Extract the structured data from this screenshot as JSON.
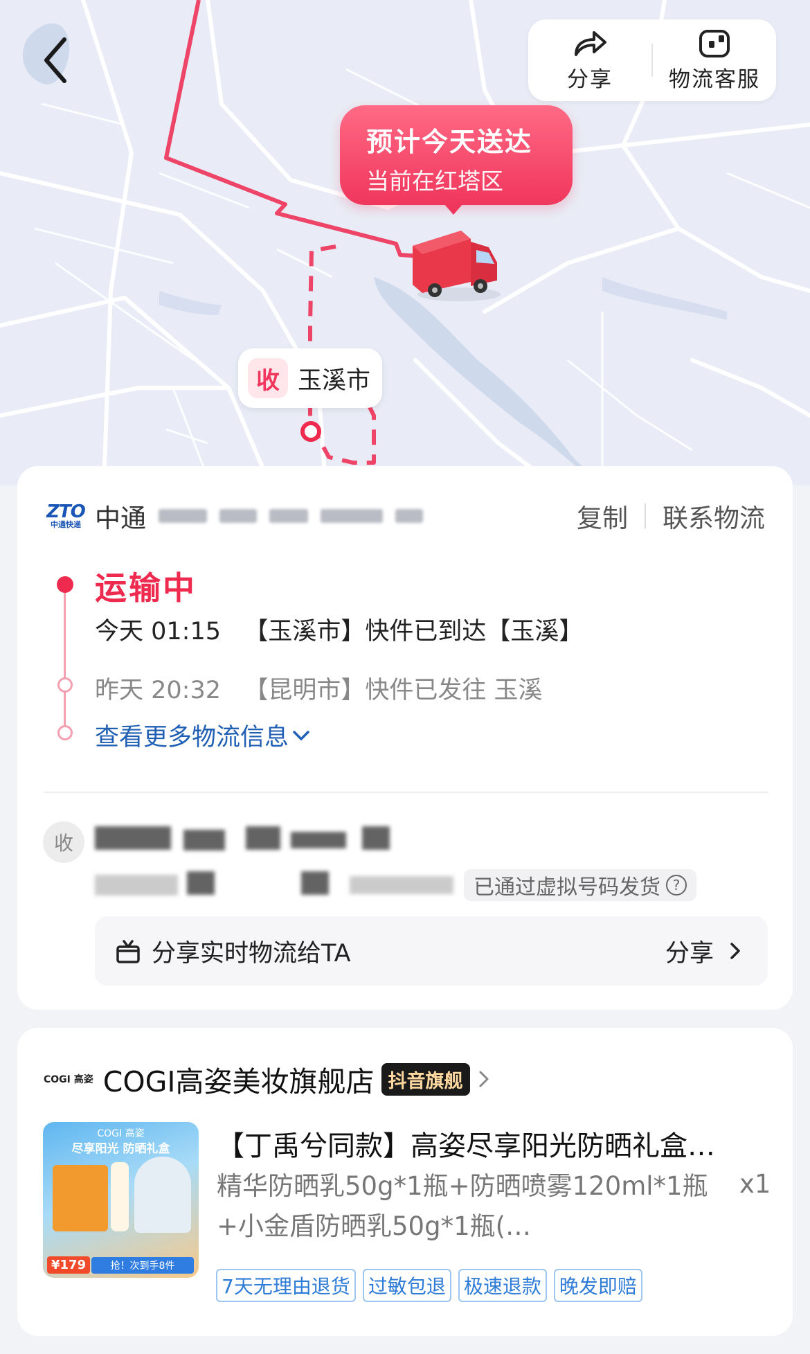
{
  "map": {
    "eta_title": "预计今天送达",
    "eta_subtitle": "当前在红塔区",
    "destination_badge": "收",
    "destination_name": "玉溪市"
  },
  "top_actions": {
    "share_label": "分享",
    "service_label": "物流客服"
  },
  "carrier": {
    "logo_text": "ZTO",
    "logo_sub": "中通快递",
    "name_prefix": "中通",
    "copy_label": "复制",
    "contact_label": "联系物流"
  },
  "tracking": {
    "status": "运输中",
    "events": [
      {
        "time": "今天 01:15",
        "text": "【玉溪市】快件已到达【玉溪】"
      },
      {
        "time": "昨天 20:32",
        "text": "【昆明市】快件已发往 玉溪"
      }
    ],
    "more_label": "查看更多物流信息"
  },
  "receiver": {
    "badge": "收",
    "virtual_tag": "已通过虚拟号码发货",
    "help_icon": "?"
  },
  "share_box": {
    "label": "分享实时物流给TA",
    "action": "分享"
  },
  "store": {
    "logo": "COGI 高姿",
    "name": "COGI高姿美妆旗舰店",
    "tag": "抖音旗舰"
  },
  "product": {
    "image_logo": "COGI 高姿",
    "image_title": "尽享阳光 防晒礼盒",
    "image_price": "¥179",
    "image_strip": "抢！次到手8件",
    "title": "【丁禹兮同款】高姿尽享阳光防晒礼盒…",
    "spec": "精华防晒乳50g*1瓶+防晒喷雾120ml*1瓶+小金盾防晒乳50g*1瓶(…",
    "qty": "x1",
    "tags": [
      "7天无理由退货",
      "过敏包退",
      "极速退款",
      "晚发即赔"
    ]
  },
  "colors": {
    "accent": "#ee2a4f",
    "link": "#1f5fb4",
    "route": "#ee4468"
  }
}
